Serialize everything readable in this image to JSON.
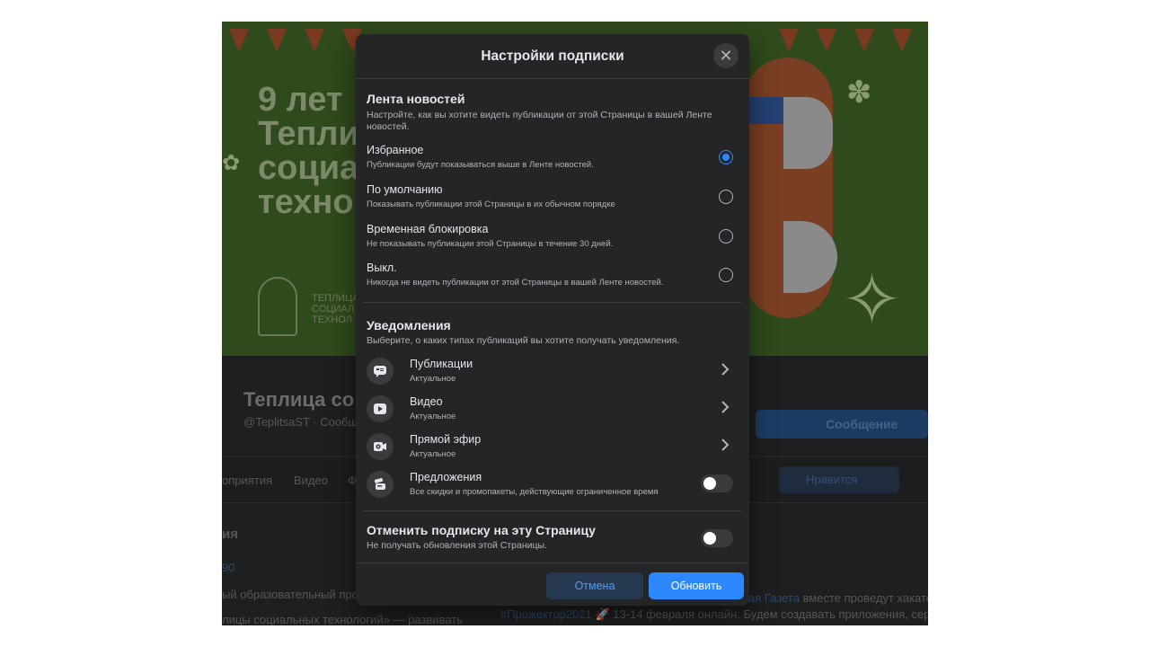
{
  "background_page": {
    "cover_title": "9 лет\nТепли\nсоциа\nтехно",
    "cover_logo_text": "ТЕПЛИЦА\nСОЦИАЛ\nТЕХНОЛ",
    "page_name": "Теплица со",
    "page_handle": "@TeplitsaST · Сообщ",
    "message_button": "Сообщение",
    "tabs": [
      "оприятия",
      "Видео",
      "Ф"
    ],
    "like_button": "Нравится",
    "left_title": "ия",
    "left_link": "90",
    "left_text_1": "ый образовательный про",
    "left_text_2": "лицы социальных технологий» — развивать",
    "right_text_1_link": "ая Газета",
    "right_text_1": " вместе проведут хакатон",
    "right_text_2_link": "#Прожектор2021",
    "right_text_2": " 🚀 13-14 февраля онлайн. Будем создавать приложения, сервисы,"
  },
  "modal": {
    "title": "Настройки подписки",
    "close_label": "✕",
    "feed": {
      "title": "Лента новостей",
      "subtitle": "Настройте, как вы хотите видеть публикации от этой Страницы в вашей Ленте новостей.",
      "options": [
        {
          "label": "Избранное",
          "desc": "Публикации будут показываться выше в Ленте новостей.",
          "checked": true
        },
        {
          "label": "По умолчанию",
          "desc": "Показывать публикации этой Страницы в их обычном порядке",
          "checked": false
        },
        {
          "label": "Временная блокировка",
          "desc": "Не показывать публикации этой Страницы в течение 30 дней.",
          "checked": false
        },
        {
          "label": "Выкл.",
          "desc": "Никогда не видеть публикации от этой Страницы в вашей Ленте новостей.",
          "checked": false
        }
      ]
    },
    "notifications": {
      "title": "Уведомления",
      "subtitle": "Выберите, о каких типах публикаций вы хотите получать уведомления.",
      "items": [
        {
          "label": "Публикации",
          "desc": "Актуальное",
          "icon": "post-icon",
          "control": "chevron"
        },
        {
          "label": "Видео",
          "desc": "Актуальное",
          "icon": "video-icon",
          "control": "chevron"
        },
        {
          "label": "Прямой эфир",
          "desc": "Актуальное",
          "icon": "live-video-icon",
          "control": "chevron"
        },
        {
          "label": "Предложения",
          "desc": "Все скидки и промопакеты, действующие ограниченное время",
          "icon": "offer-icon",
          "control": "toggle",
          "on": false
        }
      ]
    },
    "unfollow": {
      "title": "Отменить подписку на эту Страницу",
      "subtitle": "Не получать обновления этой Страницы.",
      "on": false
    },
    "buttons": {
      "cancel": "Отмена",
      "update": "Обновить"
    }
  },
  "colors": {
    "accent": "#2d88ff",
    "modal_bg": "#242526",
    "text_primary": "#e4e6eb",
    "text_secondary": "#b0b3b8"
  }
}
